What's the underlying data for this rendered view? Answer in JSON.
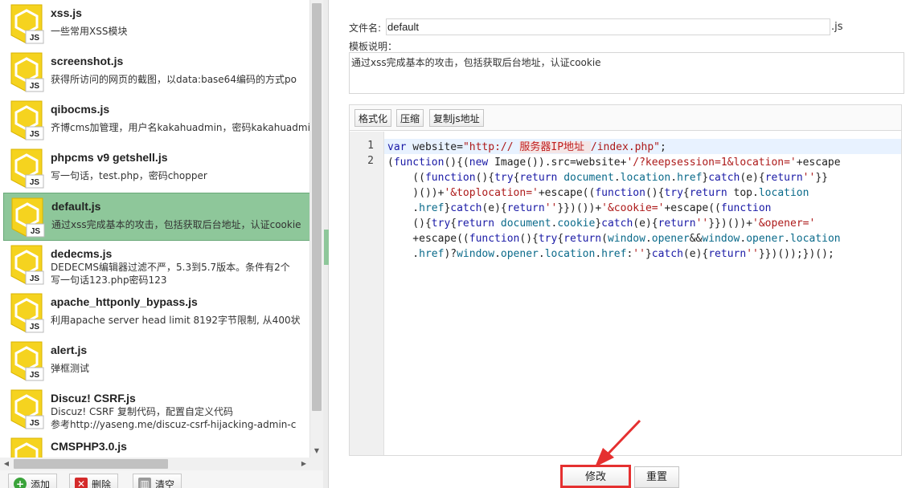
{
  "templates": [
    {
      "name": "xss.js",
      "desc": [
        "一些常用XSS模块"
      ],
      "selected": false
    },
    {
      "name": "screenshot.js",
      "desc": [
        "获得所访问的网页的截图，以data:base64编码的方式po"
      ],
      "selected": false
    },
    {
      "name": "qibocms.js",
      "desc": [
        "齐博cms加管理，用户名kakahuadmin，密码kakahuadmin"
      ],
      "selected": false
    },
    {
      "name": "phpcms v9 getshell.js",
      "desc": [
        "写一句话，test.php，密码chopper"
      ],
      "selected": false
    },
    {
      "name": "default.js",
      "desc": [
        "通过xss完成基本的攻击，包括获取后台地址，认证cookie"
      ],
      "selected": true
    },
    {
      "name": "dedecms.js",
      "desc": [
        "DEDECMS编辑器过滤不严，5.3到5.7版本。条件有2个",
        "写一句话123.php密码123"
      ],
      "selected": false
    },
    {
      "name": "apache_httponly_bypass.js",
      "desc": [
        "利用apache server head limit 8192字节限制, 从400状"
      ],
      "selected": false
    },
    {
      "name": "alert.js",
      "desc": [
        "弹框测试"
      ],
      "selected": false
    },
    {
      "name": "Discuz!  CSRF.js",
      "desc": [
        "Discuz!  CSRF  复制代码，配置自定义代码",
        "参考http://yaseng.me/discuz-csrf-hijacking-admin-c"
      ],
      "selected": false
    },
    {
      "name": "CMSPHP3.0.js",
      "desc": [
        ""
      ],
      "selected": false
    }
  ],
  "icons": {
    "template": "js-file-icon",
    "js_label": "JS"
  },
  "left_toolbar": {
    "add_label": "添加",
    "delete_label": "删除",
    "clear_label": "清空"
  },
  "form": {
    "filename_label": "文件名:",
    "filename_value": "default",
    "filename_suffix": ".js",
    "desc_label": "模板说明：",
    "desc_value": "通过xss完成基本的攻击，包括获取后台地址，认证cookie"
  },
  "editor": {
    "format_label": "格式化",
    "compress_label": "压缩",
    "copy_url_label": "复制js地址",
    "line_numbers": [
      "1",
      "2"
    ]
  },
  "actions": {
    "save_label": "修改",
    "reset_label": "重置"
  },
  "colors": {
    "selected": "#8ec79a",
    "icon_yellow": "#f5d31f",
    "annotation": "#e53030"
  }
}
